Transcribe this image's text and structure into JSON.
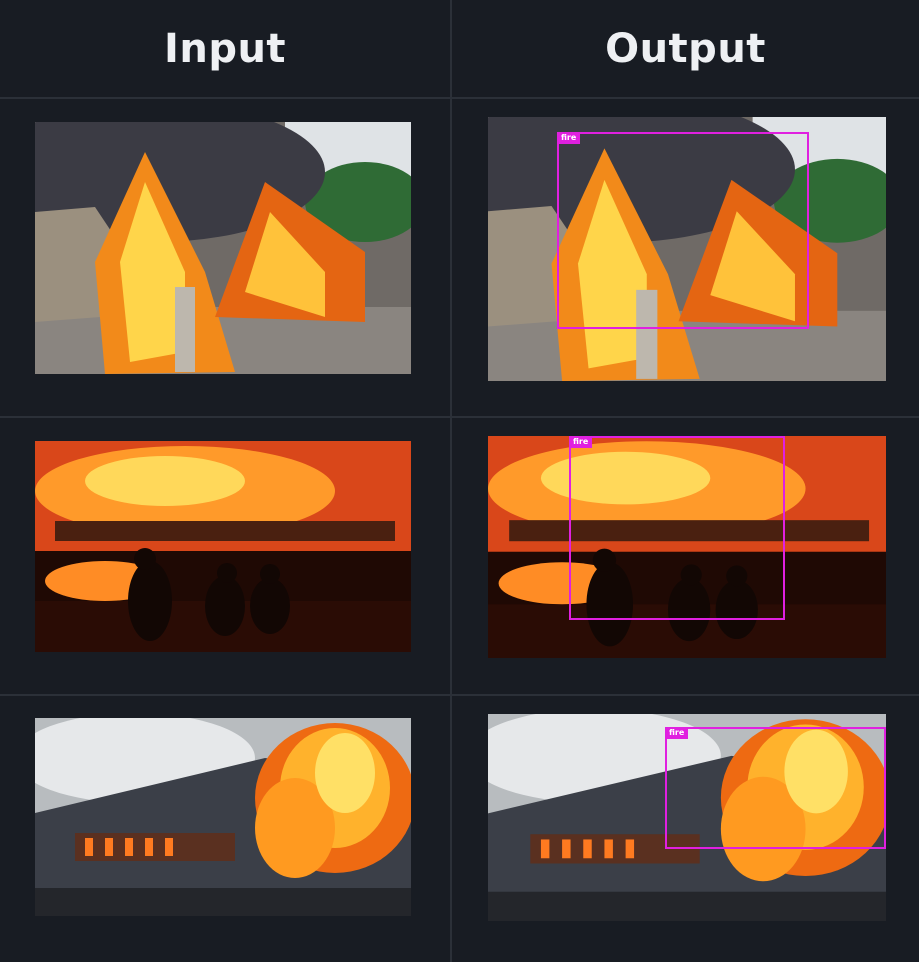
{
  "columns": {
    "input": "Input",
    "output": "Output"
  },
  "rows": [
    {
      "scene": "burning-huts",
      "detection_label": "fire"
    },
    {
      "scene": "firefighters",
      "detection_label": "fire"
    },
    {
      "scene": "burning-train",
      "detection_label": "fire"
    }
  ],
  "colors": {
    "background": "#181c23",
    "divider": "#2b3038",
    "box": "#e020e0",
    "header_text": "#eef0f3"
  }
}
